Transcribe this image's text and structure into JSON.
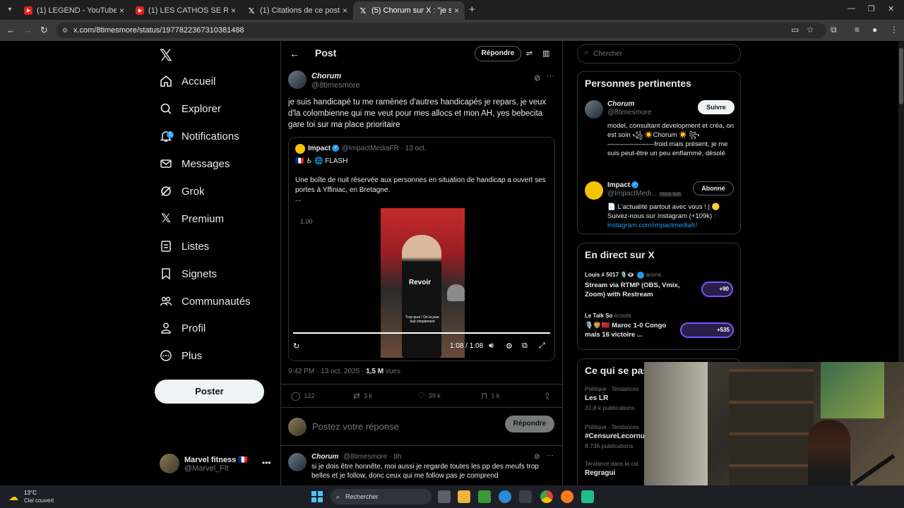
{
  "browser": {
    "tabs": [
      {
        "title": "(1) LEGEND - YouTube",
        "favicon": "youtube-icon",
        "active": false
      },
      {
        "title": "(1) LES CATHOS SE REBELLENT",
        "favicon": "youtube-icon",
        "active": false
      },
      {
        "title": "(1) Citations de ce post / X",
        "favicon": "x-icon",
        "active": false
      },
      {
        "title": "(5) Chorum sur X : \"je suis handi",
        "favicon": "x-icon",
        "active": true
      }
    ],
    "url": "x.com/8timesmore/status/1977822367310381488"
  },
  "nav": {
    "items": [
      {
        "label": "Accueil",
        "icon": "home-icon"
      },
      {
        "label": "Explorer",
        "icon": "search-icon"
      },
      {
        "label": "Notifications",
        "icon": "bell-icon",
        "badge": "5"
      },
      {
        "label": "Messages",
        "icon": "mail-icon"
      },
      {
        "label": "Grok",
        "icon": "grok-icon"
      },
      {
        "label": "Premium",
        "icon": "x-icon"
      },
      {
        "label": "Listes",
        "icon": "list-icon"
      },
      {
        "label": "Signets",
        "icon": "bookmark-icon"
      },
      {
        "label": "Communautés",
        "icon": "communities-icon"
      },
      {
        "label": "Profil",
        "icon": "person-icon"
      },
      {
        "label": "Plus",
        "icon": "more-circle-icon"
      }
    ],
    "post_button": "Poster",
    "account": {
      "name": "Marvel fitness 🇫🇷",
      "handle": "@Marvel_Flt"
    }
  },
  "post": {
    "header_title": "Post",
    "reply_button": "Répondre",
    "author_name": "Chorum",
    "author_handle": "@8timesmore",
    "text": "je suis handicapé tu me ramènes d'autres handicapés je repars, je veux d'la colombienne qui me veut pour mes allocs et mon AH, yes bebecita gare toi sur ma place prioritaire",
    "quote": {
      "author_name": "Impact",
      "author_handle": "@ImpactMediaFR · 13 oct.",
      "flash": "🇫🇷 ♿ 🌐 FLASH",
      "text": "Une boîte de nuit réservée aux personnes en situation de handicap a ouvert ses portes à Yffiniac, en Bretagne.",
      "ellipsis": "...",
      "video_number": "1.00",
      "video_caption": "Trop quoi ! On la joue tout simplement",
      "replay_label": "Revoir",
      "time": "1:08 / 1:08",
      "progress": 1.0
    },
    "timestamp": "9:42 PM · 13 oct. 2025 · ",
    "views_count": "1,5 M",
    "views_label": " vues",
    "stats": {
      "replies": "122",
      "reposts": "3 k",
      "likes": "39 k",
      "bookmarks": "1 k"
    },
    "reply_placeholder": "Postez votre réponse",
    "reply_submit": "Répondre"
  },
  "reply": {
    "author_name": "Chorum",
    "author_handle": "@8timesmore · 8h",
    "text": "si je dois être honnête, moi aussi je regarde toutes les pp des meufs trop belles et je follow, donc ceux qui me follow pas je comprend"
  },
  "sidebar": {
    "search_placeholder": "Chercher",
    "relevant_title": "Personnes pertinentes",
    "people": [
      {
        "name": "Chorum",
        "handle": "@8timesmore",
        "button": "Suivre",
        "bio": "model, consultant development et créa, on est soin ꧁ ☀️Chorum ☀️ ꧂ ———————froid mais présent, je me suis peut-être un peu enflammé, désolé"
      },
      {
        "name": "Impact",
        "handle": "@ImpactMedi...",
        "follows_you": "Vous suit",
        "button": "Abonné",
        "bio": "📄 L'actualité partout avec vous ! | 🟡 Suivez-nous sur Instagram (+109k) :",
        "link": "instagram.com/impactmediafr/"
      }
    ],
    "live_title": "En direct sur X",
    "live": [
      {
        "host": "Louis # 5017 🎙️👁️",
        "status": "anime.",
        "title": "Stream via RTMP (OBS, Vmix, Zoom) with Restream",
        "count": "+90"
      },
      {
        "host": "Le Talk So",
        "status": "écoute.",
        "title": "🎙️🦁🇲🇦 Maroc 1-0 Congo mais 16 victoire ...",
        "count": "+535"
      }
    ],
    "trends_title": "Ce qui se pas",
    "trends": [
      {
        "category": "Politique · Tendances",
        "name": "Les LR",
        "count": "31,8 k publications"
      },
      {
        "category": "Politique · Tendances",
        "name": "#CensureLecornu",
        "count": "8 736 publications"
      },
      {
        "category": "Tendance dans la cat",
        "name": "Regragui",
        "count": ""
      }
    ]
  },
  "taskbar": {
    "temperature": "13°C",
    "condition": "Ciel couvert",
    "search_label": "Rechercher"
  }
}
